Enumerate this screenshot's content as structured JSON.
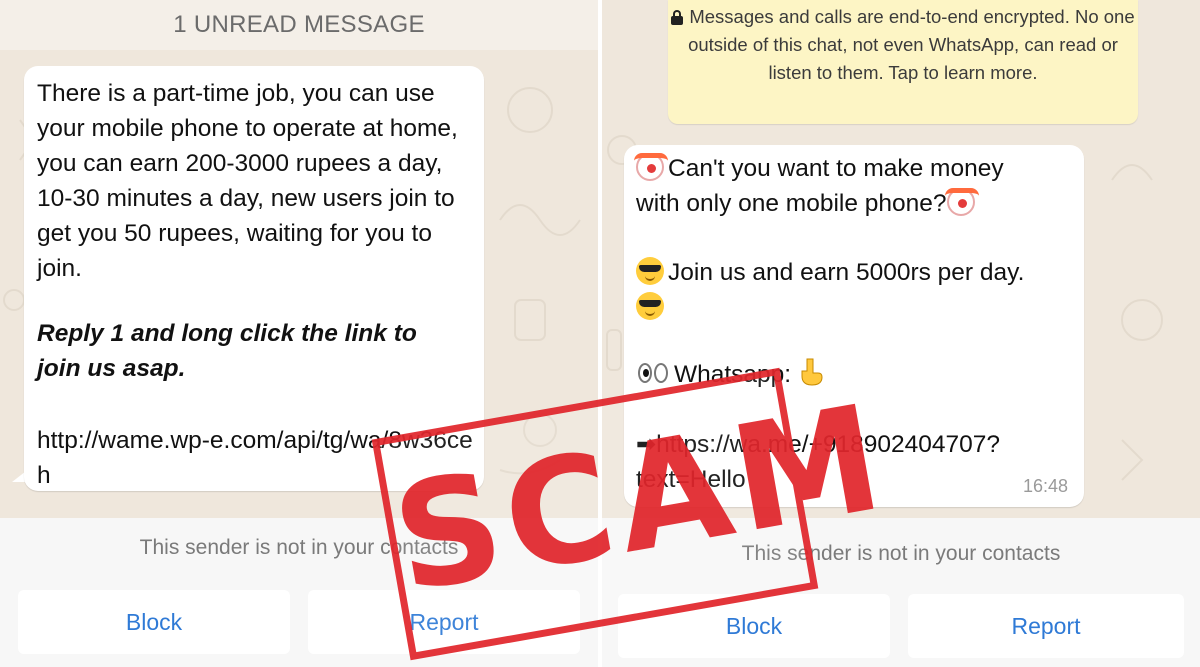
{
  "left": {
    "unread_banner": "1 UNREAD MESSAGE",
    "message": {
      "body": "There is a part-time job, you can use your mobile phone to operate at home, you can earn 200-3000 rupees a day, 10-30 minutes a day, new users join to get you 50 rupees, waiting for you to join.",
      "emphasis": "Reply 1 and long click the link to join us asap.",
      "link": "http://wame.wp-e.com/api/tg/wa/8w36ceh"
    },
    "notice": "This sender is not in your contacts",
    "block_label": "Block",
    "report_label": "Report"
  },
  "right": {
    "encryption_notice": "Messages and calls are end-to-end encrypted. No one outside of this chat, not even WhatsApp, can read or listen to them. Tap to learn more.",
    "message": {
      "line1": "Can't you want to make money",
      "line2": "with only one mobile phone?",
      "line3": "Join us and earn 5000rs per day.",
      "line4": "Whatsapp: ",
      "link_line1": "https://wa.me/+918902404707?",
      "link_line2": "text=Hello",
      "time": "16:48"
    },
    "notice": "This sender is not in your contacts",
    "block_label": "Block",
    "report_label": "Report"
  },
  "stamp_text": "SCAM",
  "colors": {
    "chat_bg": "#efe7dc",
    "button_text": "#2f7ad6",
    "stamp": "#e1262c",
    "encryption_bg": "#fdf5c5"
  },
  "icons": [
    "lock-icon",
    "clown-emoji-icon",
    "sunglasses-emoji-icon",
    "eyes-emoji-icon",
    "pointing-down-emoji-icon",
    "right-arrow-emoji-icon"
  ]
}
